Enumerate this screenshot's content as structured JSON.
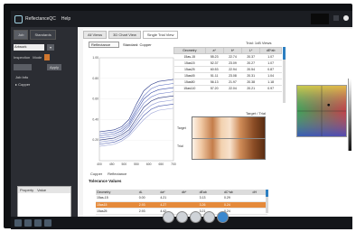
{
  "app": {
    "title": "ReflectanceQC",
    "menu": "Help"
  },
  "left_panel": {
    "tabs": [
      "Job",
      "Standards"
    ],
    "select_value": "Artwork",
    "mode_label": "Inspection",
    "mode_value": "Mode",
    "button_label": "Apply",
    "tree_header": "Job Info",
    "tree_item": "Copper",
    "property_header": [
      "Property",
      "Value"
    ]
  },
  "main": {
    "tabs": [
      "All Views",
      "3D Chart View",
      "Single Trial View"
    ],
    "dropdown_value": "Reflectance",
    "standard_label": "Standard: Copper",
    "table_title": "Trial: 1xB Views",
    "table_headers": [
      "Geometry",
      "a*",
      "b*",
      "L*",
      "dE*ab"
    ],
    "table_rows": [
      [
        "15as-15",
        "55.23",
        "22.74",
        "20.37",
        "1.07"
      ],
      [
        "15as15",
        "52.37",
        "23.09",
        "20.27",
        "1.07"
      ],
      [
        "15as25",
        "60.53",
        "22.94",
        "20.54",
        "0.87"
      ],
      [
        "15as45",
        "51.11",
        "23.08",
        "20.31",
        "1.04"
      ],
      [
        "15as80",
        "56.13",
        "21.97",
        "20.38",
        "1.18"
      ],
      [
        "15as110",
        "57.20",
        "22.04",
        "20.21",
        "0.97"
      ]
    ],
    "swatch_title": "Target / Trial",
    "swatch_labels": [
      "Target",
      "Trial"
    ],
    "legend": [
      "Copper",
      "Reflectance"
    ],
    "bottom_title": "Tolerance Values",
    "bottom_headers": [
      "Geometry",
      "dL",
      "da*",
      "db*",
      "dEab",
      "dC*ab",
      "dH"
    ],
    "bottom_rows": [
      [
        "15as-15",
        "0.00",
        "4.21",
        "",
        "3.13",
        "0.29",
        ""
      ],
      [
        "15as15",
        "2.93",
        "4.27",
        "",
        "3.26",
        "0.24",
        ""
      ],
      [
        "15as25",
        "2.93",
        "4.42",
        "",
        "3.21",
        "0.24",
        ""
      ]
    ]
  },
  "chart_data": {
    "type": "line",
    "title": "",
    "xlabel": "",
    "ylabel": "",
    "x": [
      400,
      430,
      460,
      490,
      520,
      550,
      580,
      610,
      640,
      670,
      700
    ],
    "ylim": [
      0,
      1.0
    ],
    "yticks": [
      "1.00",
      "0.80",
      "0.60",
      "0.40",
      "0.20"
    ],
    "xticks": [
      "400",
      "450",
      "500",
      "550",
      "600",
      "650",
      "700"
    ],
    "series": [
      {
        "name": "Copper",
        "values": [
          0.28,
          0.29,
          0.3,
          0.33,
          0.4,
          0.55,
          0.68,
          0.74,
          0.77,
          0.78,
          0.79
        ]
      },
      {
        "name": "Reflectance",
        "values": [
          0.26,
          0.27,
          0.28,
          0.31,
          0.37,
          0.51,
          0.63,
          0.7,
          0.73,
          0.74,
          0.75
        ]
      },
      {
        "name": "",
        "values": [
          0.24,
          0.25,
          0.26,
          0.29,
          0.35,
          0.48,
          0.6,
          0.66,
          0.69,
          0.7,
          0.71
        ]
      },
      {
        "name": "",
        "values": [
          0.22,
          0.23,
          0.24,
          0.27,
          0.33,
          0.45,
          0.56,
          0.62,
          0.65,
          0.66,
          0.67
        ]
      },
      {
        "name": "",
        "values": [
          0.2,
          0.21,
          0.22,
          0.25,
          0.3,
          0.41,
          0.52,
          0.58,
          0.61,
          0.62,
          0.63
        ]
      },
      {
        "name": "",
        "values": [
          0.18,
          0.19,
          0.2,
          0.23,
          0.28,
          0.38,
          0.48,
          0.54,
          0.57,
          0.58,
          0.59
        ]
      },
      {
        "name": "",
        "values": [
          0.16,
          0.17,
          0.18,
          0.21,
          0.26,
          0.35,
          0.44,
          0.5,
          0.53,
          0.54,
          0.55
        ]
      },
      {
        "name": "",
        "values": [
          0.14,
          0.15,
          0.16,
          0.19,
          0.24,
          0.32,
          0.4,
          0.46,
          0.49,
          0.5,
          0.51
        ]
      }
    ],
    "colors": [
      "#2a3a8a",
      "#5a6ec0",
      "#3b4fa8",
      "#6f7fc8",
      "#22307a",
      "#8a95d0",
      "#4455aa",
      "#a0a8d8"
    ]
  }
}
